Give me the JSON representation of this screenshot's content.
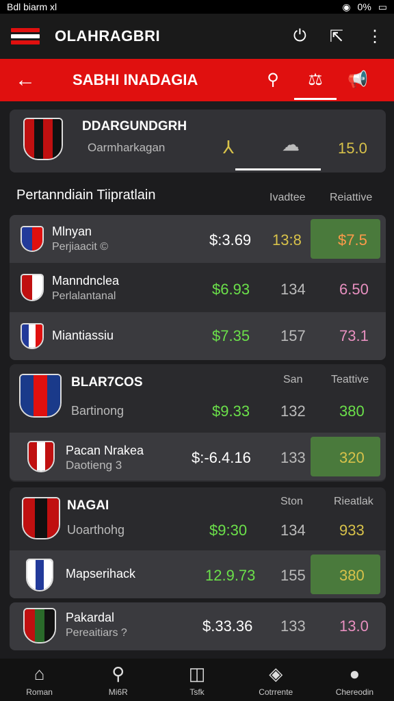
{
  "status": {
    "left": "Bdl biarm xl",
    "right": "0%"
  },
  "appbar": {
    "title": "OLAHRAGBRI"
  },
  "subbar": {
    "title": "SABHI INADAGIA"
  },
  "featured": {
    "team": "DDARGUNDGRH",
    "sub": "Oarmharkagan",
    "value": "15.0"
  },
  "section": {
    "title": "Pertanndiain Tiipratlain",
    "col1": "Ivadtee",
    "col2": "Reiattive"
  },
  "group1": [
    {
      "name": "Mlnyan",
      "sub": "Perjiaacit ©",
      "price": "$:3.69",
      "mid": "13:8",
      "val": "$7.5"
    },
    {
      "name": "Manndnclea",
      "sub": "Perlalantanal",
      "price": "$6.93",
      "mid": "134",
      "val": "6.50"
    },
    {
      "name": "Miantiassiu",
      "sub": "",
      "price": "$7.35",
      "mid": "157",
      "val": "73.1"
    }
  ],
  "group2": {
    "title": "BLAR7COS",
    "col1": "San",
    "col2": "Teattive",
    "rows": [
      {
        "name": "",
        "sub": "Bartinong",
        "price": "$9.33",
        "mid": "132",
        "val": "380"
      },
      {
        "name": "Pacan Nrakea",
        "sub": "Daotieng 3",
        "price": "$:-6.4.16",
        "mid": "133",
        "val": "320"
      }
    ]
  },
  "group3": {
    "title": "NAGAI",
    "col1": "Ston",
    "col2": "Rieatlak",
    "rows": [
      {
        "name": "",
        "sub": "Uoarthohg",
        "price": "$9:30",
        "mid": "134",
        "val": "933"
      },
      {
        "name": "Mapserihack",
        "sub": "",
        "price": "12.9.73",
        "mid": "155",
        "val": "380"
      }
    ]
  },
  "group4": {
    "name": "Pakardal",
    "sub": "Pereaitiars ?",
    "price": "$.33.36",
    "mid": "133",
    "val": "13.0"
  },
  "nav": [
    "Roman",
    "Mi6R",
    "Tsfk",
    "Cotrrente",
    "Chereodin"
  ]
}
